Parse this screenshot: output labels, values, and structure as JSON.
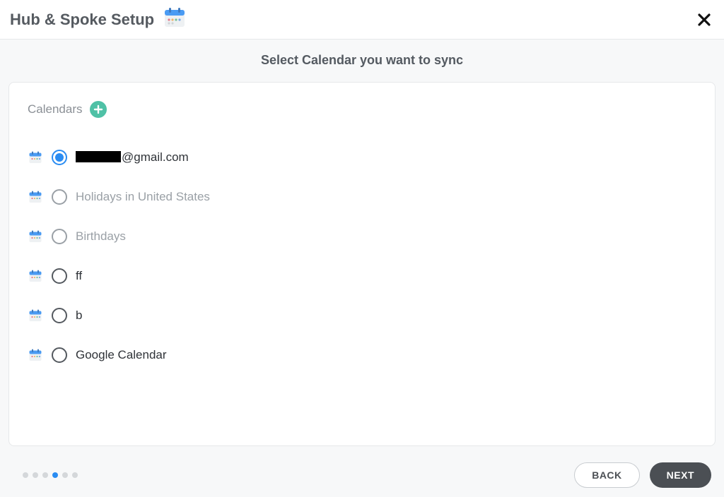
{
  "header": {
    "title": "Hub & Spoke Setup"
  },
  "subtitle": "Select Calendar you want to sync",
  "section": {
    "title": "Calendars"
  },
  "calendars": [
    {
      "label_suffix": "@gmail.com",
      "redacted": true,
      "selected": true,
      "disabled": false
    },
    {
      "label": "Holidays in United States",
      "selected": false,
      "disabled": true
    },
    {
      "label": "Birthdays",
      "selected": false,
      "disabled": true
    },
    {
      "label": "ff",
      "selected": false,
      "disabled": false
    },
    {
      "label": "b",
      "selected": false,
      "disabled": false
    },
    {
      "label": "Google Calendar",
      "selected": false,
      "disabled": false
    }
  ],
  "progress": {
    "total": 6,
    "current": 4
  },
  "buttons": {
    "back": "BACK",
    "next": "NEXT"
  },
  "colors": {
    "accent": "#2A8CF2",
    "add": "#4fc1a6",
    "nextBtn": "#4b4f54"
  }
}
